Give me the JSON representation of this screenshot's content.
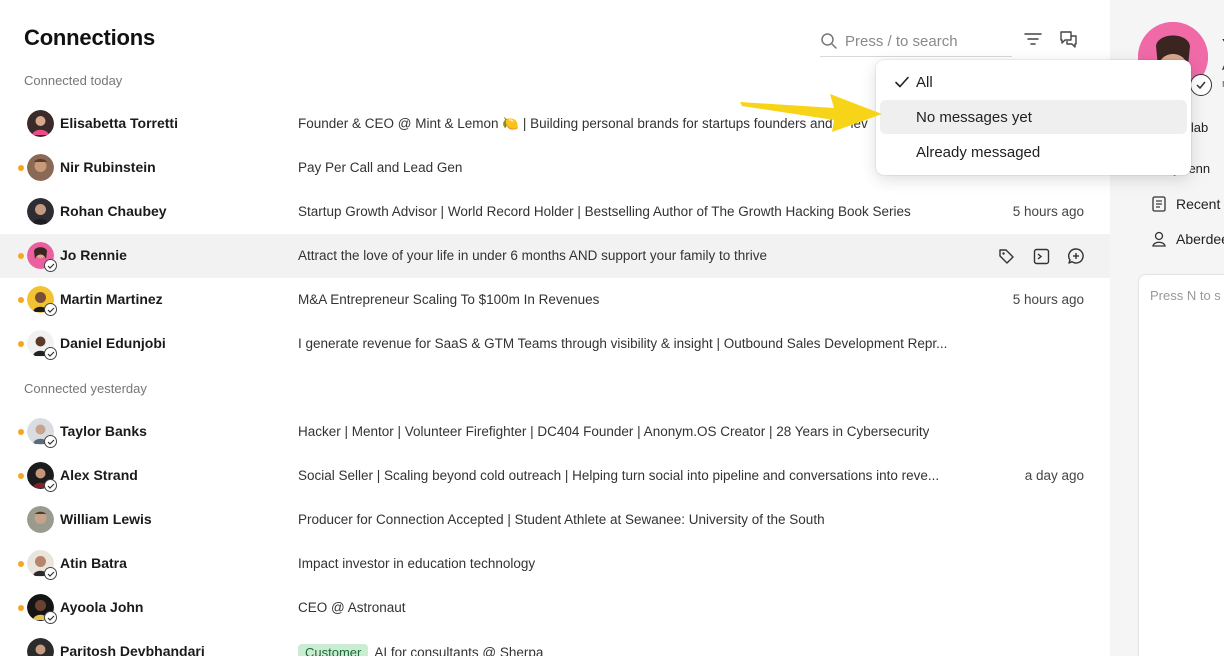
{
  "header": {
    "title": "Connections",
    "search_placeholder": "Press / to search"
  },
  "sections": [
    {
      "label": "Connected today"
    },
    {
      "label": "Connected yesterday"
    }
  ],
  "rows": [
    {
      "name": "Elisabetta Torretti",
      "headline": "Founder & CEO @ Mint & Lemon 🍋 | Building personal brands for startups founders and C-lev",
      "time": "",
      "dot": false,
      "badge": false
    },
    {
      "name": "Nir Rubinstein",
      "headline": "Pay Per Call and Lead Gen",
      "time": "",
      "dot": true,
      "badge": false
    },
    {
      "name": "Rohan Chaubey",
      "headline": "Startup Growth Advisor | World Record Holder | Bestselling Author of The Growth Hacking Book Series",
      "time": "5 hours ago",
      "dot": false,
      "badge": false
    },
    {
      "name": "Jo Rennie",
      "headline": "Attract the love of your life in under 6 months AND support your family to thrive",
      "time": "",
      "dot": true,
      "badge": true
    },
    {
      "name": "Martin Martinez",
      "headline": "M&A Entrepreneur Scaling To $100m In Revenues",
      "time": "5 hours ago",
      "dot": true,
      "badge": true
    },
    {
      "name": "Daniel Edunjobi",
      "headline": "I generate revenue for SaaS & GTM Teams through visibility & insight | Outbound Sales Development Repr...",
      "time": "",
      "dot": true,
      "badge": true
    },
    {
      "name": "Taylor Banks",
      "headline": "Hacker | Mentor | Volunteer Firefighter | DC404 Founder | Anonym.OS Creator | 28 Years in Cybersecurity",
      "time": "",
      "dot": true,
      "badge": true
    },
    {
      "name": "Alex Strand",
      "headline": "Social Seller | Scaling beyond cold outreach | Helping turn social into pipeline and conversations into reve...",
      "time": "a day ago",
      "dot": true,
      "badge": true
    },
    {
      "name": "William Lewis",
      "headline": "Producer for Connection Accepted | Student Athlete at Sewanee: University of the South",
      "time": "",
      "dot": false,
      "badge": false
    },
    {
      "name": "Atin Batra",
      "headline": "Impact investor in education technology",
      "time": "",
      "dot": true,
      "badge": true
    },
    {
      "name": "Ayoola John",
      "headline": "CEO @ Astronaut",
      "time": "",
      "dot": true,
      "badge": true
    },
    {
      "name": "Paritosh Devbhandari",
      "headline": "AI for consultants @ Sherpa",
      "tag": "Customer",
      "time": "",
      "dot": false,
      "badge": false
    }
  ],
  "filter_menu": {
    "items": [
      {
        "label": "All",
        "checked": true
      },
      {
        "label": "No messages yet",
        "checked": false
      },
      {
        "label": "Already messaged",
        "checked": false
      }
    ]
  },
  "right_panel": {
    "name_initial": "Y",
    "line2": "A",
    "line3": "n",
    "add_label": "d lab",
    "handle": "jorenn",
    "recent": "Recent",
    "location": "Aberdee",
    "note_placeholder": "Press N to s"
  },
  "colors": {
    "accent_dot": "#f5a623",
    "arrow": "#f7d417",
    "tag_bg": "#c9ecd3",
    "hover_row": "#f2f2f2"
  }
}
